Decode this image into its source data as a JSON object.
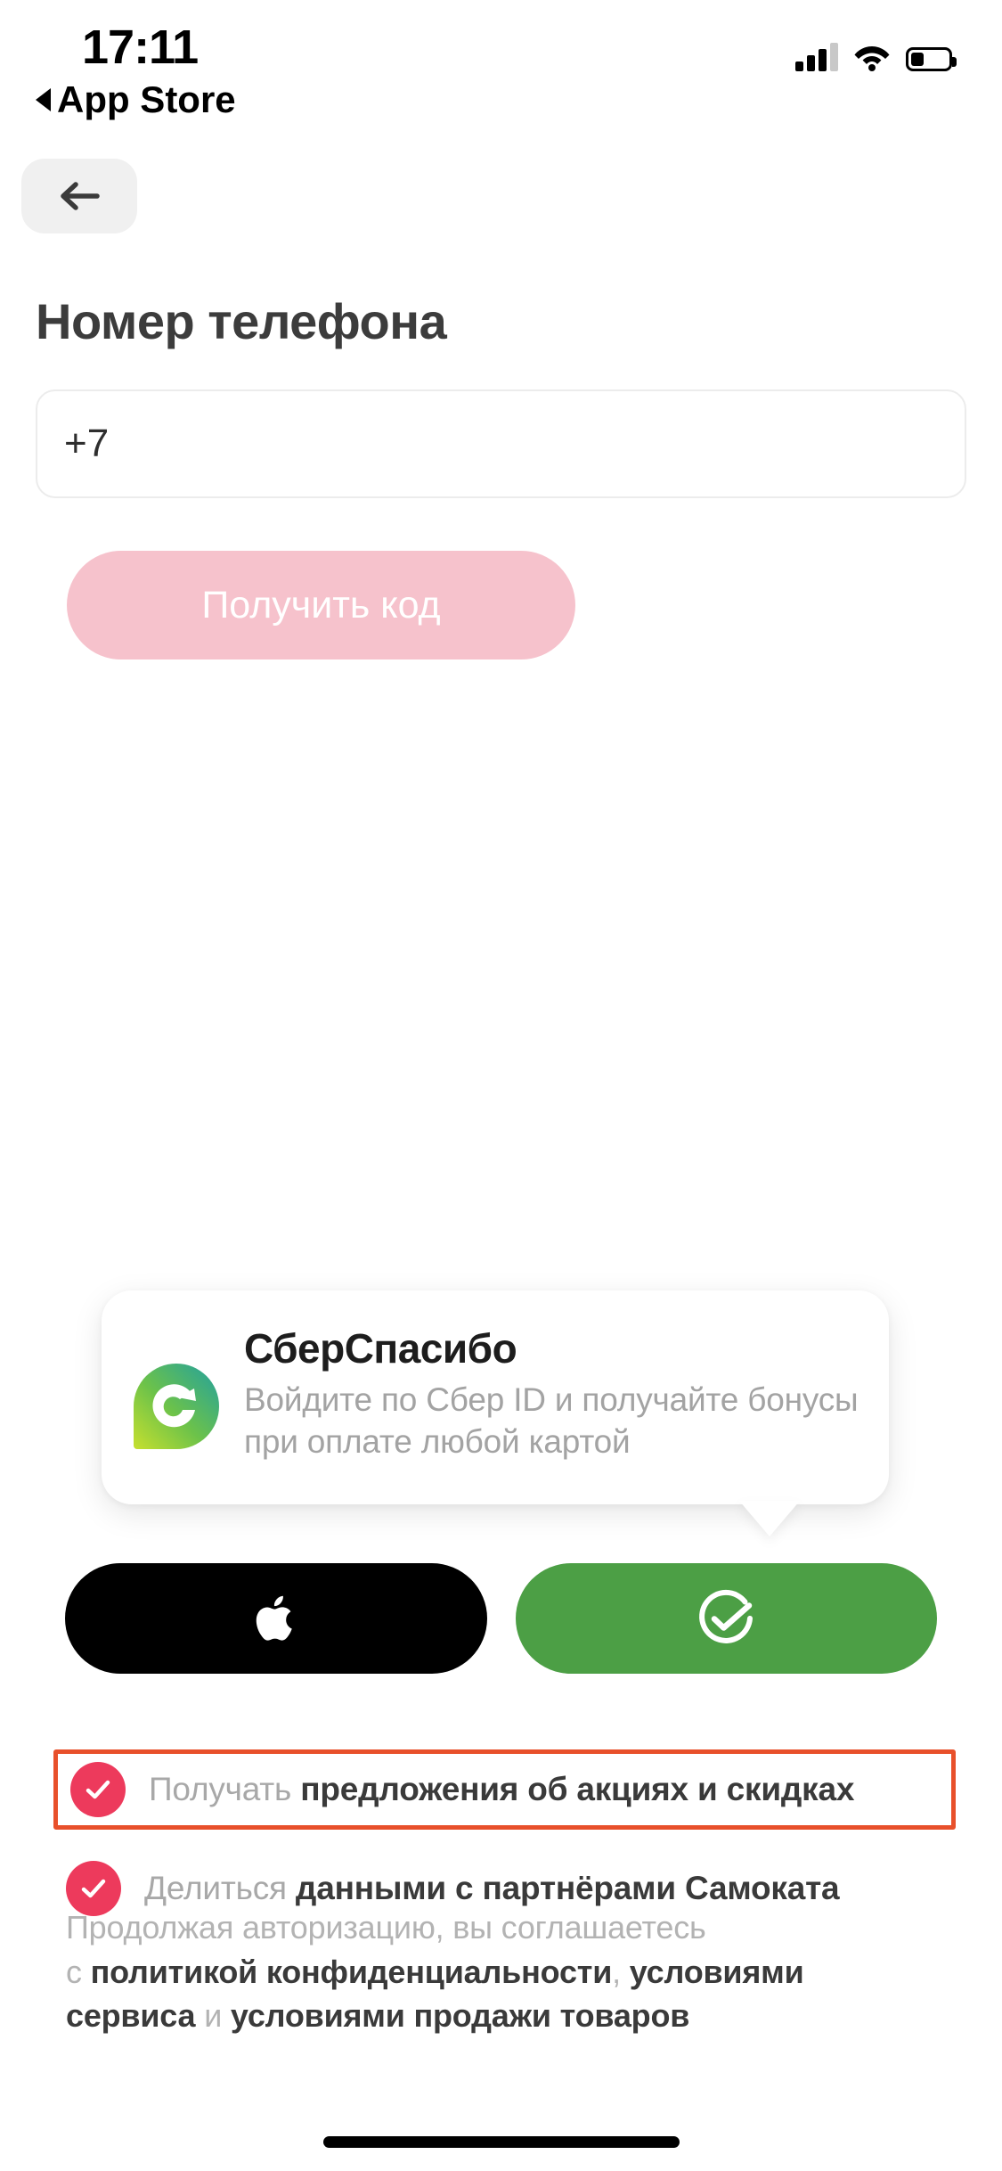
{
  "status_bar": {
    "time": "17:11",
    "return_label": "App Store",
    "icons": [
      "cellular-signal-icon",
      "wifi-icon",
      "battery-icon"
    ],
    "battery_level_pct": 36
  },
  "nav": {
    "back_icon": "arrow-left-icon"
  },
  "header": {
    "title": "Номер телефона"
  },
  "phone_input": {
    "value": "+7",
    "placeholder": "+7"
  },
  "primary_button": {
    "label": "Получить код",
    "color": "#f6c2cc",
    "text_color": "#ffffff",
    "enabled": false
  },
  "promo_card": {
    "logo_icon": "sber-spasibo-pin-icon",
    "title": "СберСпасибо",
    "subtitle": "Войдите по Сбер ID и получайте бонусы при оплате любой картой"
  },
  "social_buttons": [
    {
      "name": "apple-sign-in",
      "icon": "apple-logo-icon",
      "background": "#000000",
      "icon_color": "#ffffff"
    },
    {
      "name": "sber-sign-in",
      "icon": "sber-check-circle-icon",
      "background": "#4c9f45",
      "icon_color": "#ffffff"
    }
  ],
  "consents": [
    {
      "checked": true,
      "prefix": "Получать ",
      "emphasis": "предложения об акциях и скидках",
      "highlighted": true,
      "highlight_color": "#e8502b"
    },
    {
      "checked": true,
      "prefix": "Делиться ",
      "emphasis": "данными с партнёрами Самоката",
      "highlighted": false,
      "highlight_color": ""
    }
  ],
  "legal": {
    "line1_plain": "Продолжая авторизацию, вы соглашаетесь",
    "line2_plain_a": "с ",
    "line2_bold_a": "политикой конфиденциальности",
    "line2_plain_b": ", ",
    "line2_bold_b": "условиями",
    "line3_bold_c": "сервиса",
    "line3_plain_c": " и ",
    "line3_bold_d": "условиями продажи товаров"
  },
  "colors": {
    "accent_pink": "#ed3a5c",
    "button_pink": "#f6c2cc",
    "sber_green": "#4c9f45",
    "highlight_orange": "#e8502b",
    "muted_text": "#a8a8a8",
    "dark_text": "#3a3a3a"
  }
}
